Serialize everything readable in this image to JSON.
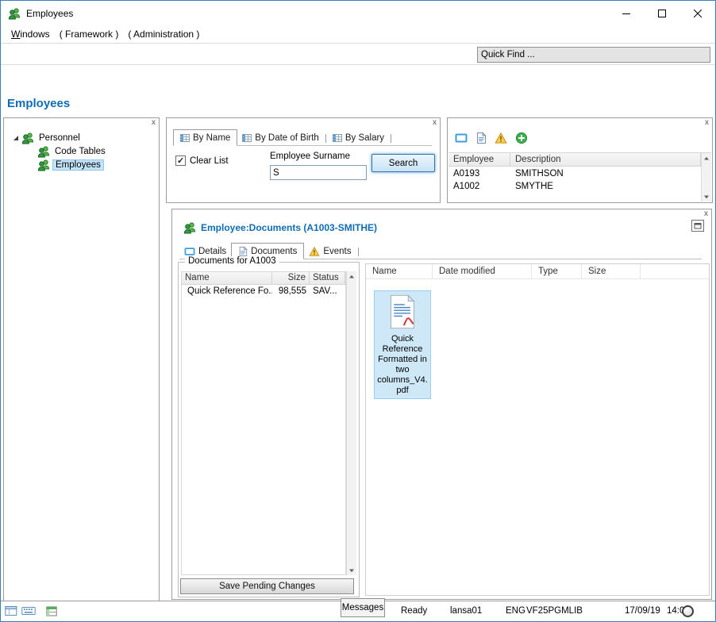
{
  "icons": {
    "close": "x"
  },
  "window": {
    "title": "Employees"
  },
  "menu": {
    "items": [
      {
        "label": "Windows"
      },
      {
        "label": "( Framework )"
      },
      {
        "label": "( Administration )"
      }
    ]
  },
  "toolbar": {
    "quick_find": "Quick Find ..."
  },
  "page": {
    "title": "Employees"
  },
  "tree_panel": {
    "root": {
      "label": "Personnel"
    },
    "items": [
      {
        "label": "Code Tables"
      },
      {
        "label": "Employees",
        "selected": true
      }
    ]
  },
  "search_panel": {
    "tabs": [
      {
        "label": "By Name",
        "active": true
      },
      {
        "label": "By Date of Birth"
      },
      {
        "label": "By Salary"
      }
    ],
    "clear_list_label": "Clear List",
    "clear_list_checked": true,
    "surname_label": "Employee Surname",
    "surname_value": "S",
    "search_button": "Search"
  },
  "results_panel": {
    "columns": [
      "Employee",
      "Description"
    ],
    "rows": [
      {
        "employee": "A0193",
        "description": "SMITHSON"
      },
      {
        "employee": "A1002",
        "description": "SMYTHE"
      }
    ]
  },
  "doc_panel": {
    "title": "Employee:Documents (A1003-SMITHE)",
    "tabs": [
      {
        "label": "Details"
      },
      {
        "label": "Documents",
        "active": true
      },
      {
        "label": "Events"
      }
    ],
    "group_title": "Documents for A1003",
    "doc_table": {
      "columns": [
        "Name",
        "Size",
        "Status"
      ],
      "rows": [
        {
          "name": "Quick Reference Fo...",
          "size": "98,555",
          "status": "SAV..."
        }
      ]
    },
    "save_button": "Save Pending Changes",
    "file_list": {
      "columns": [
        "Name",
        "Date modified",
        "Type",
        "Size"
      ],
      "files": [
        {
          "name": "Quick Reference Formatted in two columns_V4. pdf"
        }
      ]
    }
  },
  "status_bar": {
    "messages": "Messages",
    "state": "Ready",
    "user": "lansa01",
    "language": "ENG",
    "library": "VF25PGMLIB",
    "date": "17/09/19",
    "time": "14:03"
  }
}
